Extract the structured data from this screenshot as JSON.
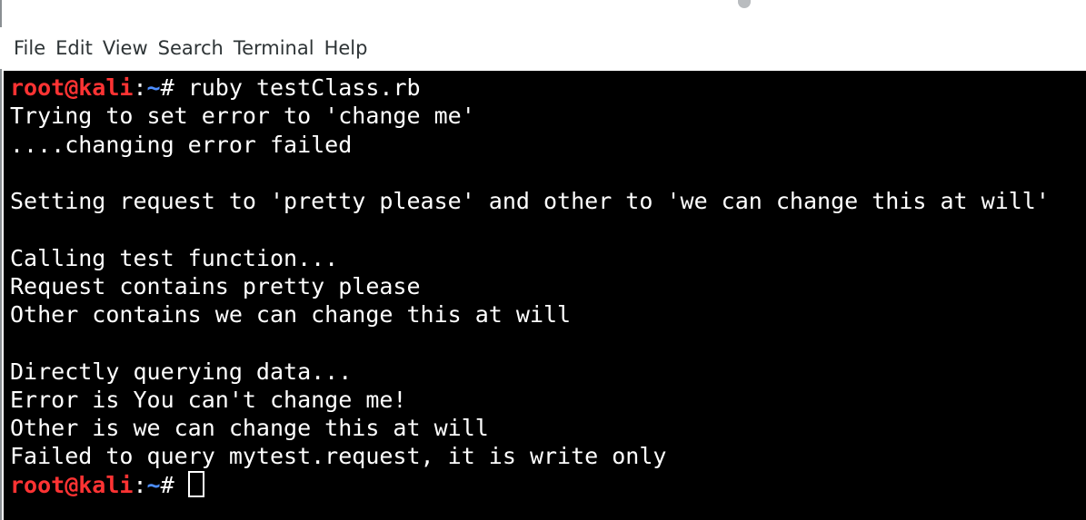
{
  "window": {
    "menu": [
      "File",
      "Edit",
      "View",
      "Search",
      "Terminal",
      "Help"
    ]
  },
  "prompt": {
    "user_host": "root@kali",
    "separator": ":",
    "path": "~",
    "symbol": "# "
  },
  "terminal": {
    "command": "ruby testClass.rb",
    "output": [
      "Trying to set error to 'change me'",
      "....changing error failed",
      "",
      "Setting request to 'pretty please' and other to 'we can change this at will'",
      "",
      "Calling test function...",
      "Request contains pretty please",
      "Other contains we can change this at will",
      "",
      "Directly querying data...",
      "Error is You can't change me!",
      "Other is we can change this at will",
      "Failed to query mytest.request, it is write only"
    ]
  },
  "colors": {
    "background": "#000000",
    "text": "#ffffff",
    "prompt_user": "#ff3333",
    "prompt_path": "#4d8eff",
    "menubar": "#ffffff"
  }
}
